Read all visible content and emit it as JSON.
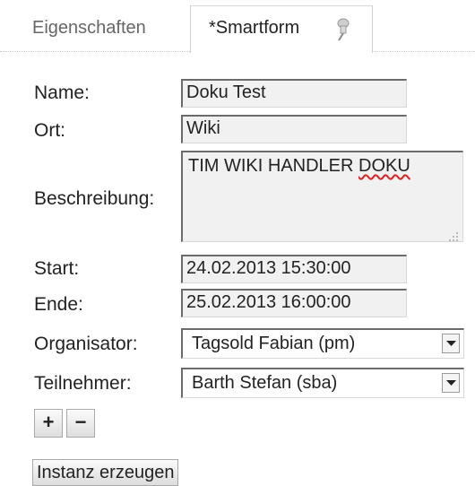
{
  "tabs": {
    "properties_label": "Eigenschaften",
    "smartform_label": "*Smartform",
    "pin_icon": "pushpin-icon"
  },
  "form": {
    "name_label": "Name:",
    "name_value": "Doku Test",
    "location_label": "Ort:",
    "location_value": "Wiki",
    "description_label": "Beschreibung:",
    "description_value_main": "TIM WIKI HANDLER ",
    "description_value_misspelled": "DOKU",
    "start_label": "Start:",
    "start_value": "24.02.2013 15:30:00",
    "end_label": "Ende:",
    "end_value": "25.02.2013 16:00:00",
    "organizer_label": "Organisator:",
    "organizer_value": "Tagsold Fabian (pm)",
    "participant_label": "Teilnehmer:",
    "participant_value": "Barth Stefan (sba)"
  },
  "buttons": {
    "add_label": "+",
    "remove_label": "−",
    "create_instance_label": "Instanz erzeugen"
  }
}
